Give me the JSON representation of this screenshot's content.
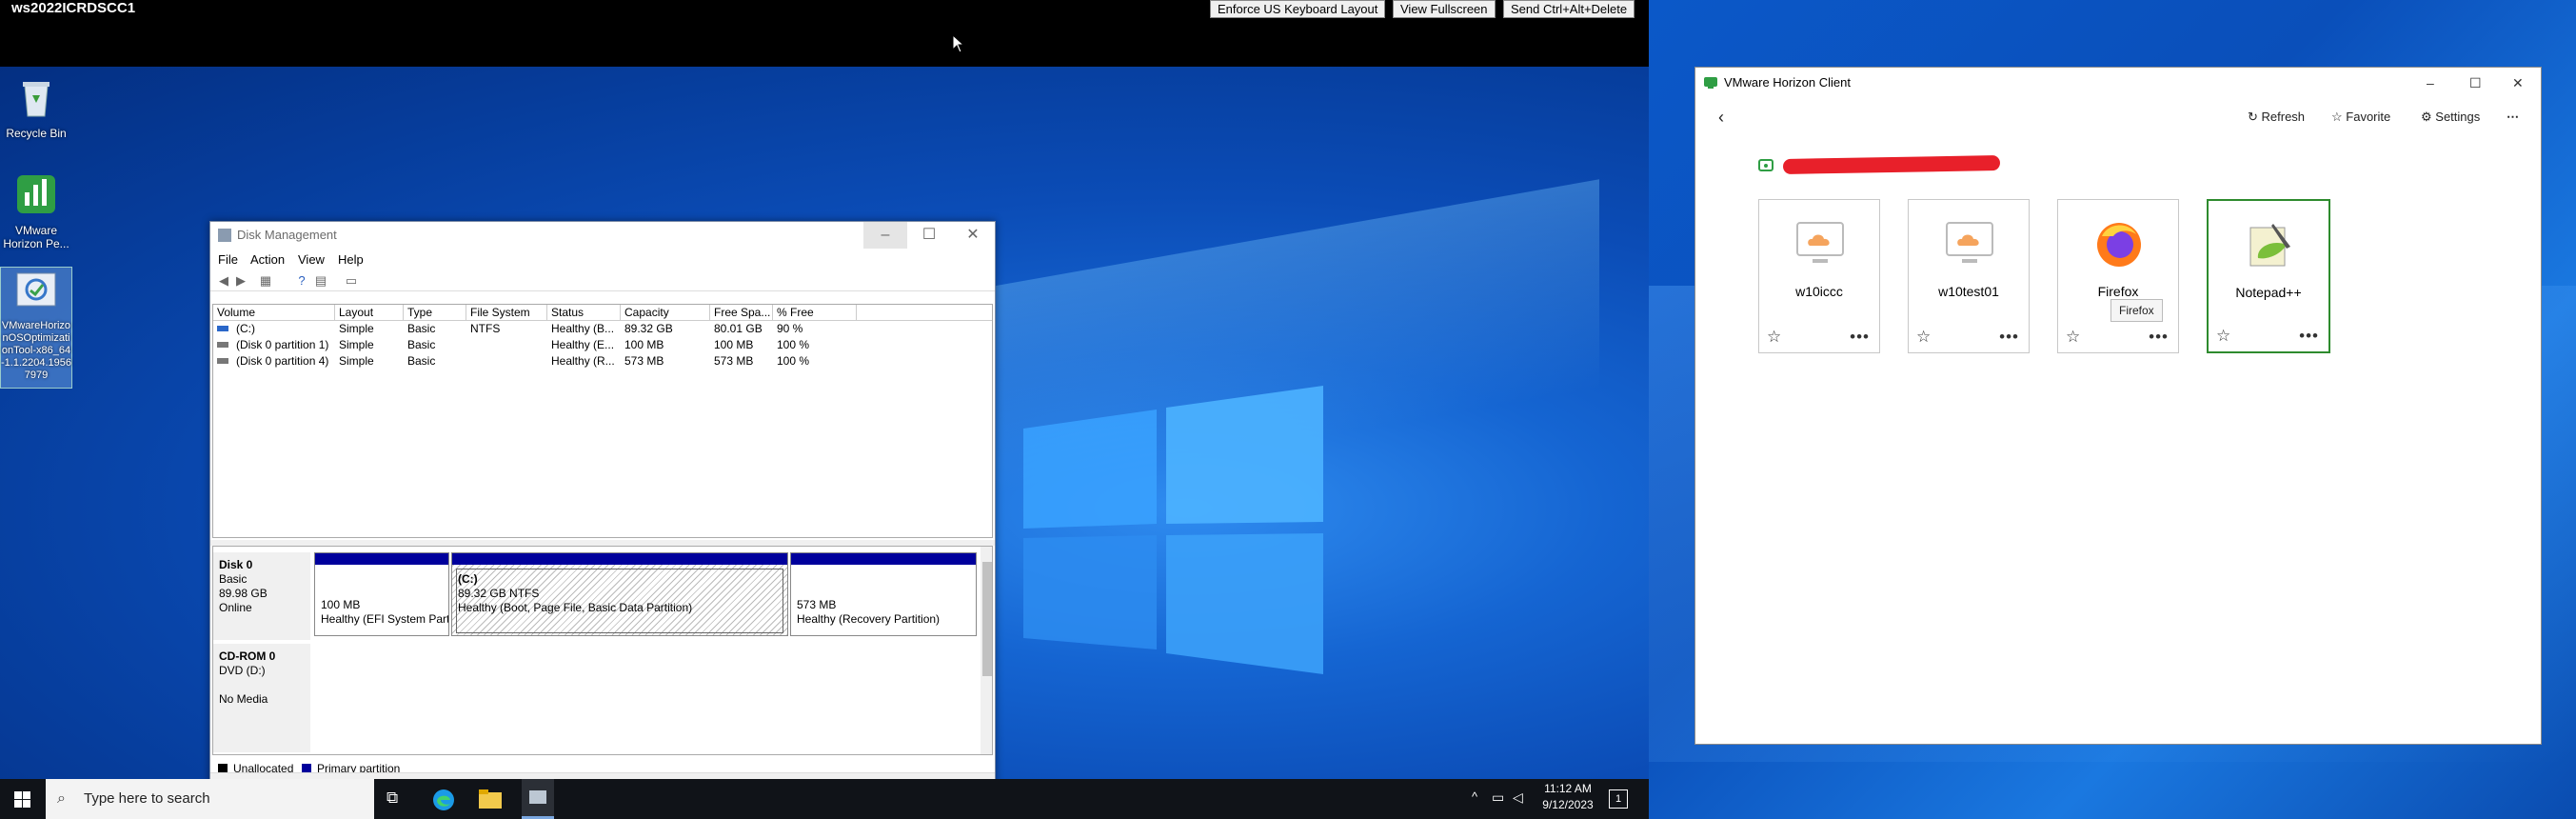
{
  "remote": {
    "title": "ws2022ICRDSCC1",
    "buttons": [
      "Enforce US Keyboard Layout",
      "View Fullscreen",
      "Send Ctrl+Alt+Delete"
    ]
  },
  "desktop_icons": [
    {
      "label": "Recycle Bin",
      "icon": "recycle-bin-icon"
    },
    {
      "label": "VMware Horizon Pe...",
      "icon": "vmware-horizon-icon"
    },
    {
      "label": "VMwareHorizonOSOptimizationTool-x86_64-1.1.2204.19567979",
      "icon": "optimization-tool-icon"
    }
  ],
  "disk_management": {
    "title": "Disk Management",
    "menu": [
      "File",
      "Action",
      "View",
      "Help"
    ],
    "columns": [
      "Volume",
      "Layout",
      "Type",
      "File System",
      "Status",
      "Capacity",
      "Free Spa...",
      "% Free"
    ],
    "rows": [
      [
        "(C:)",
        "Simple",
        "Basic",
        "NTFS",
        "Healthy (B...",
        "89.32 GB",
        "80.01 GB",
        "90 %"
      ],
      [
        "(Disk 0 partition 1)",
        "Simple",
        "Basic",
        "",
        "Healthy (E...",
        "100 MB",
        "100 MB",
        "100 %"
      ],
      [
        "(Disk 0 partition 4)",
        "Simple",
        "Basic",
        "",
        "Healthy (R...",
        "573 MB",
        "573 MB",
        "100 %"
      ]
    ],
    "disk0": {
      "name": "Disk 0",
      "type": "Basic",
      "size": "89.98 GB",
      "state": "Online",
      "partitions": [
        {
          "line1": "",
          "line2": "100 MB",
          "line3": "Healthy (EFI System Part"
        },
        {
          "line1": "(C:)",
          "line2": "89.32 GB NTFS",
          "line3": "Healthy (Boot, Page File, Basic Data Partition)"
        },
        {
          "line1": "",
          "line2": "573 MB",
          "line3": "Healthy (Recovery Partition)"
        }
      ]
    },
    "cdrom": {
      "name": "CD-ROM 0",
      "type": "DVD (D:)",
      "media": "No Media"
    },
    "legend": [
      "Unallocated",
      "Primary partition"
    ],
    "colors": {
      "unallocated": "#000000",
      "primary": "#00009c"
    }
  },
  "taskbar": {
    "search_placeholder": "Type here to search",
    "time": "11:12 AM",
    "date": "9/12/2023",
    "notification_count": "1"
  },
  "horizon": {
    "title": "VMware Horizon Client",
    "refresh": "Refresh",
    "favorite": "Favorite",
    "settings": "Settings",
    "tiles": [
      {
        "name": "w10iccc",
        "icon": "cloud-desktop-icon"
      },
      {
        "name": "w10test01",
        "icon": "cloud-desktop-icon"
      },
      {
        "name": "Firefox",
        "icon": "firefox-icon"
      },
      {
        "name": "Notepad++",
        "icon": "notepad-plus-plus-icon"
      }
    ],
    "tooltip": "Firefox",
    "accent": "#2e8b2e"
  }
}
